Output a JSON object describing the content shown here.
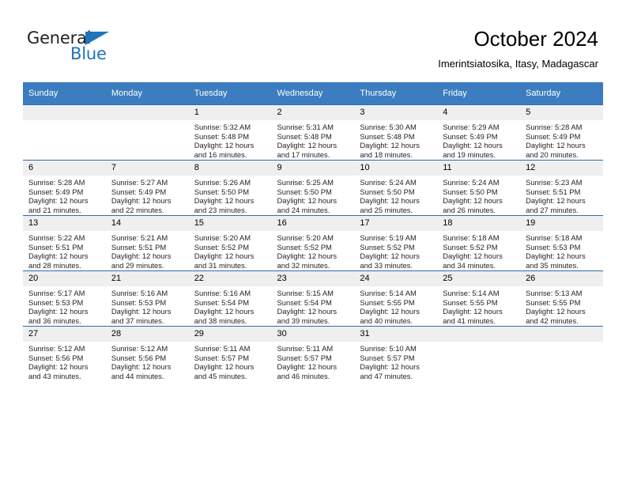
{
  "brand": {
    "name_part1": "General",
    "name_part2": "Blue",
    "flag_icon": "triangle-flag-icon",
    "accent_color": "#1f74bb"
  },
  "header": {
    "title": "October 2024",
    "subtitle": "Imerintsiatosika, Itasy, Madagascar"
  },
  "colors": {
    "header_row_bg": "#3b7dbf",
    "cell_top_border": "#2f6ead",
    "daynum_bg": "#efeff0",
    "text": "#231f20"
  },
  "calendar": {
    "weekday_headers": [
      "Sunday",
      "Monday",
      "Tuesday",
      "Wednesday",
      "Thursday",
      "Friday",
      "Saturday"
    ],
    "labels": {
      "sunrise": "Sunrise:",
      "sunset": "Sunset:",
      "daylight": "Daylight:"
    },
    "weeks": [
      [
        {
          "day": "",
          "sunrise": "",
          "sunset": "",
          "daylight_a": "",
          "daylight_b": ""
        },
        {
          "day": "",
          "sunrise": "",
          "sunset": "",
          "daylight_a": "",
          "daylight_b": ""
        },
        {
          "day": "1",
          "sunrise": "Sunrise: 5:32 AM",
          "sunset": "Sunset: 5:48 PM",
          "daylight_a": "Daylight: 12 hours",
          "daylight_b": "and 16 minutes."
        },
        {
          "day": "2",
          "sunrise": "Sunrise: 5:31 AM",
          "sunset": "Sunset: 5:48 PM",
          "daylight_a": "Daylight: 12 hours",
          "daylight_b": "and 17 minutes."
        },
        {
          "day": "3",
          "sunrise": "Sunrise: 5:30 AM",
          "sunset": "Sunset: 5:48 PM",
          "daylight_a": "Daylight: 12 hours",
          "daylight_b": "and 18 minutes."
        },
        {
          "day": "4",
          "sunrise": "Sunrise: 5:29 AM",
          "sunset": "Sunset: 5:49 PM",
          "daylight_a": "Daylight: 12 hours",
          "daylight_b": "and 19 minutes."
        },
        {
          "day": "5",
          "sunrise": "Sunrise: 5:28 AM",
          "sunset": "Sunset: 5:49 PM",
          "daylight_a": "Daylight: 12 hours",
          "daylight_b": "and 20 minutes."
        }
      ],
      [
        {
          "day": "6",
          "sunrise": "Sunrise: 5:28 AM",
          "sunset": "Sunset: 5:49 PM",
          "daylight_a": "Daylight: 12 hours",
          "daylight_b": "and 21 minutes."
        },
        {
          "day": "7",
          "sunrise": "Sunrise: 5:27 AM",
          "sunset": "Sunset: 5:49 PM",
          "daylight_a": "Daylight: 12 hours",
          "daylight_b": "and 22 minutes."
        },
        {
          "day": "8",
          "sunrise": "Sunrise: 5:26 AM",
          "sunset": "Sunset: 5:50 PM",
          "daylight_a": "Daylight: 12 hours",
          "daylight_b": "and 23 minutes."
        },
        {
          "day": "9",
          "sunrise": "Sunrise: 5:25 AM",
          "sunset": "Sunset: 5:50 PM",
          "daylight_a": "Daylight: 12 hours",
          "daylight_b": "and 24 minutes."
        },
        {
          "day": "10",
          "sunrise": "Sunrise: 5:24 AM",
          "sunset": "Sunset: 5:50 PM",
          "daylight_a": "Daylight: 12 hours",
          "daylight_b": "and 25 minutes."
        },
        {
          "day": "11",
          "sunrise": "Sunrise: 5:24 AM",
          "sunset": "Sunset: 5:50 PM",
          "daylight_a": "Daylight: 12 hours",
          "daylight_b": "and 26 minutes."
        },
        {
          "day": "12",
          "sunrise": "Sunrise: 5:23 AM",
          "sunset": "Sunset: 5:51 PM",
          "daylight_a": "Daylight: 12 hours",
          "daylight_b": "and 27 minutes."
        }
      ],
      [
        {
          "day": "13",
          "sunrise": "Sunrise: 5:22 AM",
          "sunset": "Sunset: 5:51 PM",
          "daylight_a": "Daylight: 12 hours",
          "daylight_b": "and 28 minutes."
        },
        {
          "day": "14",
          "sunrise": "Sunrise: 5:21 AM",
          "sunset": "Sunset: 5:51 PM",
          "daylight_a": "Daylight: 12 hours",
          "daylight_b": "and 29 minutes."
        },
        {
          "day": "15",
          "sunrise": "Sunrise: 5:20 AM",
          "sunset": "Sunset: 5:52 PM",
          "daylight_a": "Daylight: 12 hours",
          "daylight_b": "and 31 minutes."
        },
        {
          "day": "16",
          "sunrise": "Sunrise: 5:20 AM",
          "sunset": "Sunset: 5:52 PM",
          "daylight_a": "Daylight: 12 hours",
          "daylight_b": "and 32 minutes."
        },
        {
          "day": "17",
          "sunrise": "Sunrise: 5:19 AM",
          "sunset": "Sunset: 5:52 PM",
          "daylight_a": "Daylight: 12 hours",
          "daylight_b": "and 33 minutes."
        },
        {
          "day": "18",
          "sunrise": "Sunrise: 5:18 AM",
          "sunset": "Sunset: 5:52 PM",
          "daylight_a": "Daylight: 12 hours",
          "daylight_b": "and 34 minutes."
        },
        {
          "day": "19",
          "sunrise": "Sunrise: 5:18 AM",
          "sunset": "Sunset: 5:53 PM",
          "daylight_a": "Daylight: 12 hours",
          "daylight_b": "and 35 minutes."
        }
      ],
      [
        {
          "day": "20",
          "sunrise": "Sunrise: 5:17 AM",
          "sunset": "Sunset: 5:53 PM",
          "daylight_a": "Daylight: 12 hours",
          "daylight_b": "and 36 minutes."
        },
        {
          "day": "21",
          "sunrise": "Sunrise: 5:16 AM",
          "sunset": "Sunset: 5:53 PM",
          "daylight_a": "Daylight: 12 hours",
          "daylight_b": "and 37 minutes."
        },
        {
          "day": "22",
          "sunrise": "Sunrise: 5:16 AM",
          "sunset": "Sunset: 5:54 PM",
          "daylight_a": "Daylight: 12 hours",
          "daylight_b": "and 38 minutes."
        },
        {
          "day": "23",
          "sunrise": "Sunrise: 5:15 AM",
          "sunset": "Sunset: 5:54 PM",
          "daylight_a": "Daylight: 12 hours",
          "daylight_b": "and 39 minutes."
        },
        {
          "day": "24",
          "sunrise": "Sunrise: 5:14 AM",
          "sunset": "Sunset: 5:55 PM",
          "daylight_a": "Daylight: 12 hours",
          "daylight_b": "and 40 minutes."
        },
        {
          "day": "25",
          "sunrise": "Sunrise: 5:14 AM",
          "sunset": "Sunset: 5:55 PM",
          "daylight_a": "Daylight: 12 hours",
          "daylight_b": "and 41 minutes."
        },
        {
          "day": "26",
          "sunrise": "Sunrise: 5:13 AM",
          "sunset": "Sunset: 5:55 PM",
          "daylight_a": "Daylight: 12 hours",
          "daylight_b": "and 42 minutes."
        }
      ],
      [
        {
          "day": "27",
          "sunrise": "Sunrise: 5:12 AM",
          "sunset": "Sunset: 5:56 PM",
          "daylight_a": "Daylight: 12 hours",
          "daylight_b": "and 43 minutes."
        },
        {
          "day": "28",
          "sunrise": "Sunrise: 5:12 AM",
          "sunset": "Sunset: 5:56 PM",
          "daylight_a": "Daylight: 12 hours",
          "daylight_b": "and 44 minutes."
        },
        {
          "day": "29",
          "sunrise": "Sunrise: 5:11 AM",
          "sunset": "Sunset: 5:57 PM",
          "daylight_a": "Daylight: 12 hours",
          "daylight_b": "and 45 minutes."
        },
        {
          "day": "30",
          "sunrise": "Sunrise: 5:11 AM",
          "sunset": "Sunset: 5:57 PM",
          "daylight_a": "Daylight: 12 hours",
          "daylight_b": "and 46 minutes."
        },
        {
          "day": "31",
          "sunrise": "Sunrise: 5:10 AM",
          "sunset": "Sunset: 5:57 PM",
          "daylight_a": "Daylight: 12 hours",
          "daylight_b": "and 47 minutes."
        },
        {
          "day": "",
          "sunrise": "",
          "sunset": "",
          "daylight_a": "",
          "daylight_b": ""
        },
        {
          "day": "",
          "sunrise": "",
          "sunset": "",
          "daylight_a": "",
          "daylight_b": ""
        }
      ]
    ]
  }
}
